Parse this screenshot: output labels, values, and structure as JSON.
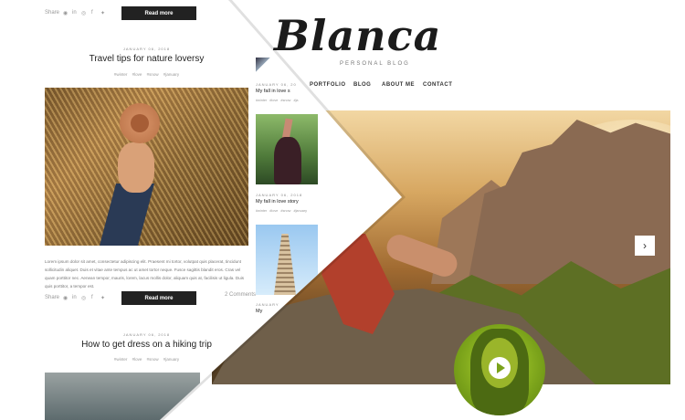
{
  "brand": {
    "logo": "Blanca",
    "tagline": "PERSONAL BLOG"
  },
  "nav": [
    "PORTFOLIO",
    "BLOG",
    "ABOUT ME",
    "CONTACT"
  ],
  "slider": {
    "next_arrow": "›"
  },
  "posts": [
    {
      "share_label": "Share",
      "read_more": "Read more"
    },
    {
      "date": "JANUARY 06, 2018",
      "title": "Travel tips for nature loversy",
      "tags": "#winter #love #snow #january",
      "excerpt": "Lorem ipsum dolor sit amet, consectetur adipiscing elit. Praesent mi tortor, volutpat quis placerat, tincidunt sollicitudin aliquet. Duis et vitae ante tempus ac ut amet tortor neque. Fusce sagittis blandit eros. Cras vel quam porttitor nec. Aenean tempor, mauris, lorem, lacus mollis dolor, aliquam quis at, facilisis ut ligula. Duis quis porttitor, a tempor est.",
      "share_label": "Share",
      "read_more": "Read more",
      "comments": "2 Comments"
    },
    {
      "date": "JANUARY 06, 2018",
      "title": "How to get dress on a hiking trip",
      "tags": "#winter #love #snow #january"
    }
  ],
  "sidebar_posts": [
    {
      "date": "JANUARY 06, 20",
      "title": "My fall in love s",
      "tags": "#winter #love #snow #ja"
    },
    {
      "date": "JANUARY 06, 2018",
      "title": "My fall in love story",
      "tags": "#winter #love #snow #january"
    },
    {
      "date": "JANUARY",
      "title": "My"
    }
  ],
  "social_icons": [
    "pinterest-icon",
    "linkedin-icon",
    "instagram-icon",
    "facebook-icon",
    "twitter-icon"
  ],
  "colors": {
    "accent_green": "#8cbf1f",
    "button_dark": "#222222"
  }
}
